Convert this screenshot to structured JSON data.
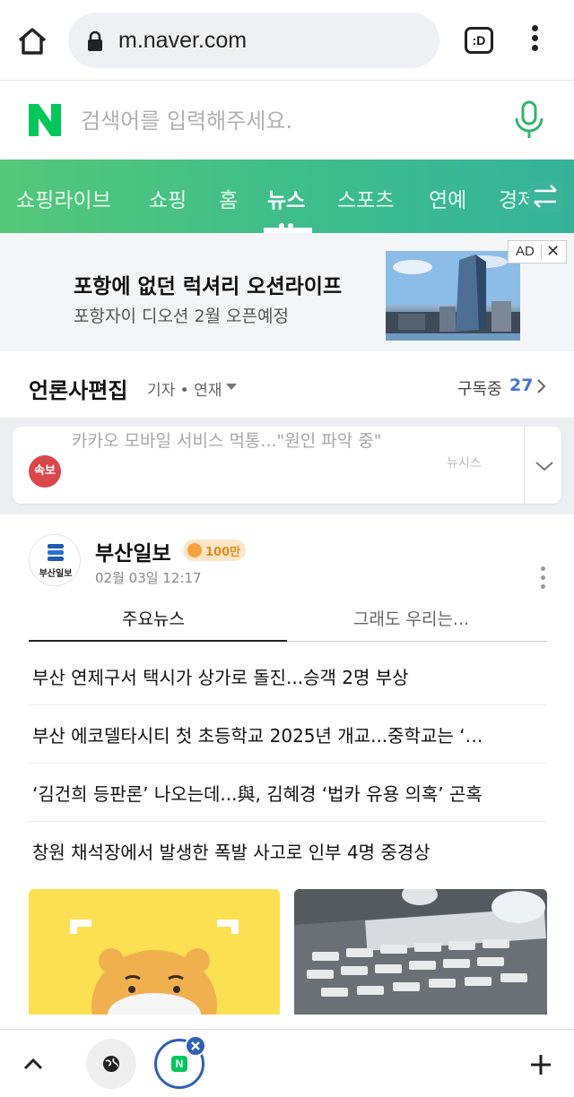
{
  "browser": {
    "url": "m.naver.com",
    "tabs_label": ":D",
    "icons": [
      "home-icon",
      "lock-icon",
      "tabs-icon",
      "more-vertical-icon"
    ]
  },
  "search": {
    "placeholder": "검색어를 입력해주세요.",
    "logo_letter": "N",
    "brand_color": "#03c75a"
  },
  "nav": {
    "items": [
      {
        "label": "쇼핑라이브"
      },
      {
        "label": "쇼핑"
      },
      {
        "label": "홈"
      },
      {
        "label": "뉴스"
      },
      {
        "label": "스포츠"
      },
      {
        "label": "연예"
      },
      {
        "label": "경제"
      }
    ],
    "active": "뉴스"
  },
  "ad": {
    "badge": "AD",
    "close": "✕",
    "title": "포항에 없던 럭셔리 오션라이프",
    "subtitle": "포항자이 디오션 2월 오픈예정"
  },
  "press_section": {
    "title": "언론사편집",
    "filter": "기자 • 연재",
    "subscribe_label": "구독중",
    "subscribe_count": "27"
  },
  "breaking": {
    "badge": "속보",
    "text": "카카오 모바일 서비스 먹통...\"원인 파악 중\"",
    "source": "뉴시스"
  },
  "press_card": {
    "logo_text": "부산일보",
    "name": "부산일보",
    "badge": "100만",
    "time": "02월 03일 12:17",
    "tabs": [
      {
        "label": "주요뉴스"
      },
      {
        "label": "그래도 우리는..."
      }
    ],
    "headlines": [
      {
        "text": "부산 연제구서 택시가 상가로 돌진...승객 2명 부상"
      },
      {
        "text": "부산 에코델타시티 첫 초등학교 2025년 개교...중학교는 ‘…"
      },
      {
        "text": "‘김건희 등판론’ 나오는데...與, 김혜경 ‘법카 유용 의혹’ 곤혹"
      },
      {
        "text": "창원 채석장에서 발생한 폭발 사고로 인부 4명 중경상"
      }
    ]
  },
  "bottom_bar": {
    "tab_logo": "N",
    "icons": [
      "chevron-up-icon",
      "globe-icon",
      "close-icon",
      "plus-icon"
    ]
  }
}
